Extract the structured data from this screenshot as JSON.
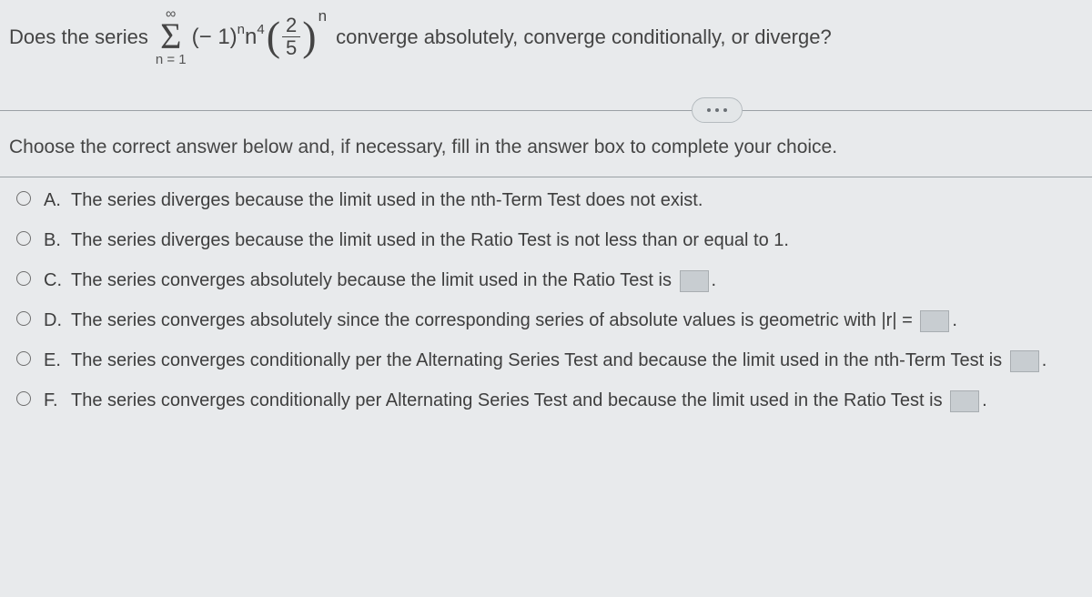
{
  "question": {
    "prefix": "Does the series",
    "suffix": "converge absolutely, converge conditionally, or diverge?",
    "sigma_top": "∞",
    "sigma_bottom": "n = 1",
    "term_base": "(− 1)",
    "term_exp1": "n",
    "term_var": "n",
    "term_exp2": "4",
    "frac_num": "2",
    "frac_den": "5",
    "frac_exp": "n"
  },
  "instruction": "Choose the correct answer below and, if necessary, fill in the answer box to complete your choice.",
  "options": {
    "A": {
      "letter": "A.",
      "text": "The series diverges because the limit used in the nth-Term Test does not exist."
    },
    "B": {
      "letter": "B.",
      "text": "The series diverges because the limit used in the Ratio Test is not less than or equal to 1."
    },
    "C": {
      "letter": "C.",
      "text_before": "The series converges absolutely because the limit used in the Ratio Test is",
      "text_after": "."
    },
    "D": {
      "letter": "D.",
      "text_before": "The series converges absolutely since the corresponding series of absolute values is geometric with |r| =",
      "text_after": "."
    },
    "E": {
      "letter": "E.",
      "text_before": "The series converges conditionally per the Alternating Series Test and because the limit used in the nth-Term Test is",
      "text_after": "."
    },
    "F": {
      "letter": "F.",
      "text_before": "The series converges conditionally per Alternating Series Test and because the limit used in the Ratio Test is",
      "text_after": "."
    }
  }
}
